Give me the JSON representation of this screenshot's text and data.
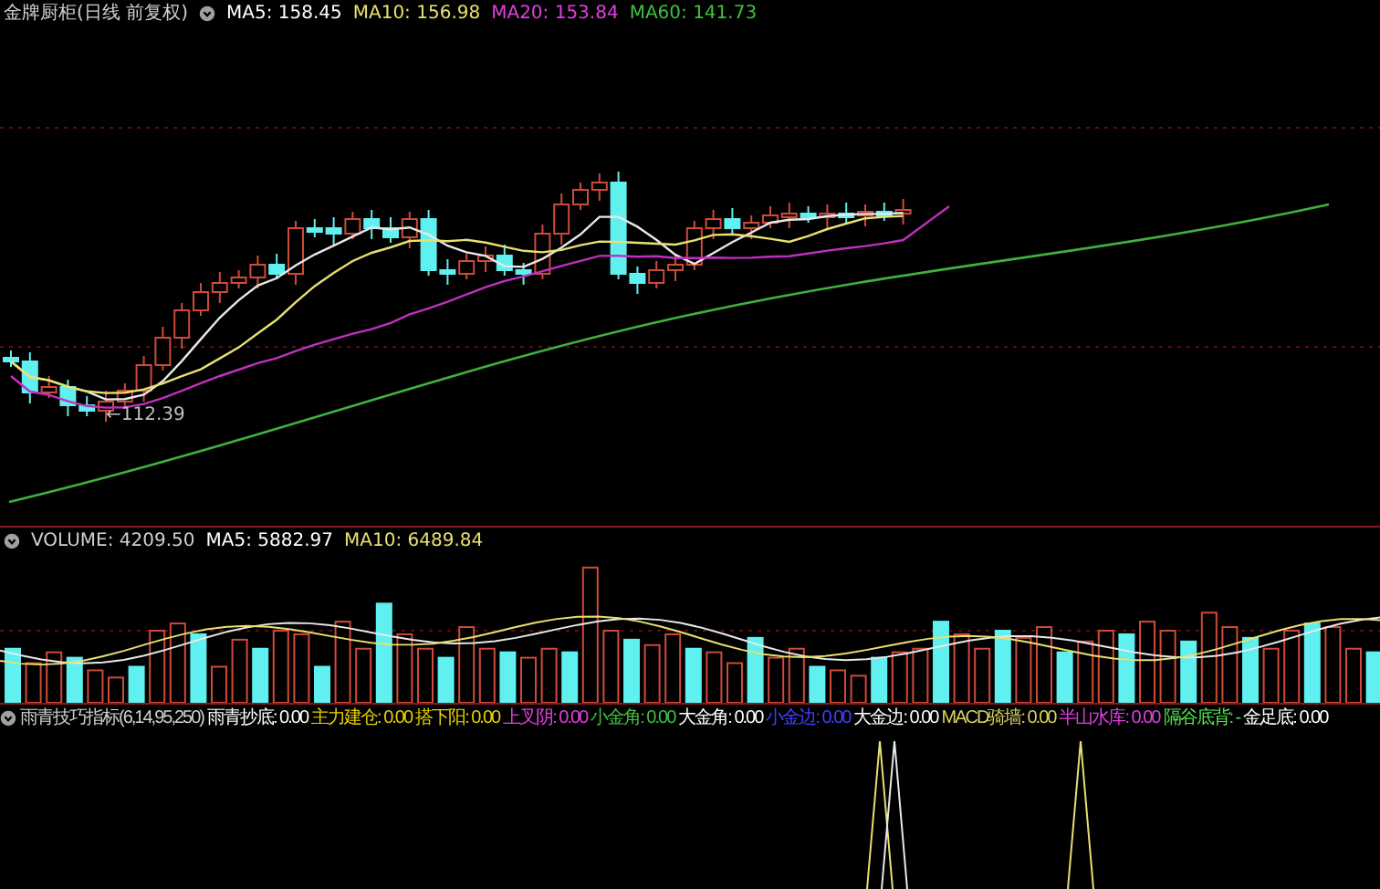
{
  "price_panel": {
    "title": "金牌厨柜(日线 前复权)",
    "legend": [
      {
        "label": "MA5: 158.45",
        "color": "#ffffff"
      },
      {
        "label": "MA10: 156.98",
        "color": "#e8e070"
      },
      {
        "label": "MA20: 153.84",
        "color": "#e040e0"
      },
      {
        "label": "MA60: 141.73",
        "color": "#40c040"
      }
    ],
    "low_marker": "←112.39"
  },
  "volume_panel": {
    "legend": [
      {
        "label": "VOLUME: 4209.50",
        "color": "#d0d0d0"
      },
      {
        "label": "MA5: 5882.97",
        "color": "#ffffff"
      },
      {
        "label": "MA10: 6489.84",
        "color": "#e8e070"
      }
    ]
  },
  "indicator_panel": {
    "title": "雨青技巧指标(6,14,95,250)",
    "legend": [
      {
        "label": "雨青抄底: 0.00",
        "color": "#ffffff"
      },
      {
        "label": "主力建仓: 0.00",
        "color": "#e8d000"
      },
      {
        "label": "搭下阳: 0.00",
        "color": "#e8d000"
      },
      {
        "label": "上叉阴: 0.00",
        "color": "#e040e0"
      },
      {
        "label": "小金角: 0.00",
        "color": "#40c040"
      },
      {
        "label": "大金角: 0.00",
        "color": "#ffffff"
      },
      {
        "label": "小金边: 0.00",
        "color": "#4040ff"
      },
      {
        "label": "大金边: 0.00",
        "color": "#ffffff"
      },
      {
        "label": "MACD骑墙: 0.00",
        "color": "#d8d060"
      },
      {
        "label": "半山水库: 0.00",
        "color": "#e040e0"
      },
      {
        "label": "隔谷底背: -",
        "color": "#50e050"
      },
      {
        "label": "金足底: 0.00",
        "color": "#ffffff"
      }
    ]
  }
}
